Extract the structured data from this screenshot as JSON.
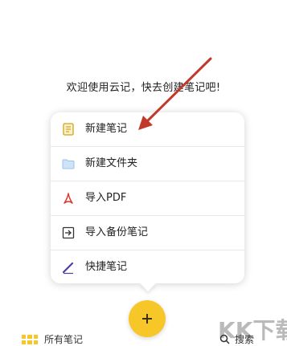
{
  "welcome_text": "欢迎使用云记，快去创建笔记吧!",
  "menu": {
    "items": [
      {
        "label": "新建笔记",
        "icon": "note-icon"
      },
      {
        "label": "新建文件夹",
        "icon": "folder-icon"
      },
      {
        "label": "导入PDF",
        "icon": "pdf-icon"
      },
      {
        "label": "导入备份笔记",
        "icon": "import-icon"
      },
      {
        "label": "快捷笔记",
        "icon": "pen-icon"
      }
    ]
  },
  "fab": {
    "icon": "plus-icon",
    "color": "#f7c629"
  },
  "bottom_bar": {
    "left_label": "所有笔记",
    "right_label": "搜索",
    "left_icon": "grid-icon",
    "right_icon": "search-icon"
  },
  "annotation": {
    "arrow_color": "#c0392b"
  },
  "watermark": {
    "text": "KK下载"
  }
}
